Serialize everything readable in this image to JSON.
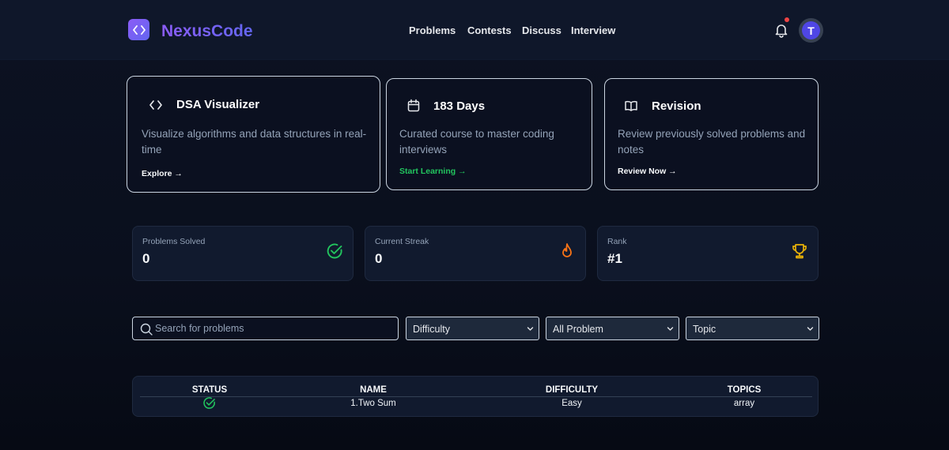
{
  "navbar": {
    "brand": "NexusCode",
    "logo_icon": "code-icon",
    "links": [
      "Problems",
      "Contests",
      "Discuss",
      "Interview"
    ],
    "avatar_initial": "T",
    "notification_dot_color": "#ef4444"
  },
  "cards": [
    {
      "icon": "code-icon",
      "title": "DSA Visualizer",
      "description": "Visualize algorithms and data structures in real-time",
      "link": "Explore →"
    },
    {
      "icon": "calendar-icon",
      "title": "183 Days",
      "description": "Curated course to master coding interviews",
      "link": "Start Learning →",
      "link_color": "#22c55e"
    },
    {
      "icon": "book-icon",
      "title": "Revision",
      "description": "Review previously solved problems and notes",
      "link": "Review Now →"
    }
  ],
  "stats": [
    {
      "label": "Problems Solved",
      "value": "0",
      "icon": "check-circle-icon",
      "color": "#22c55e"
    },
    {
      "label": "Current Streak",
      "value": "0",
      "icon": "flame-icon",
      "color": "#f97316"
    },
    {
      "label": "Rank",
      "value": "#1",
      "icon": "trophy-icon",
      "color": "#eab308"
    }
  ],
  "filters": {
    "search_placeholder": "Search for problems",
    "difficulty": "Difficulty",
    "problem_filter": "All Problem",
    "topic": "Topic"
  },
  "table": {
    "columns": [
      "STATUS",
      "NAME",
      "DIFFICULTY",
      "TOPICS"
    ],
    "rows": [
      {
        "status": "solved",
        "name": "1.Two Sum",
        "difficulty": "Easy",
        "topics": "array"
      }
    ]
  }
}
